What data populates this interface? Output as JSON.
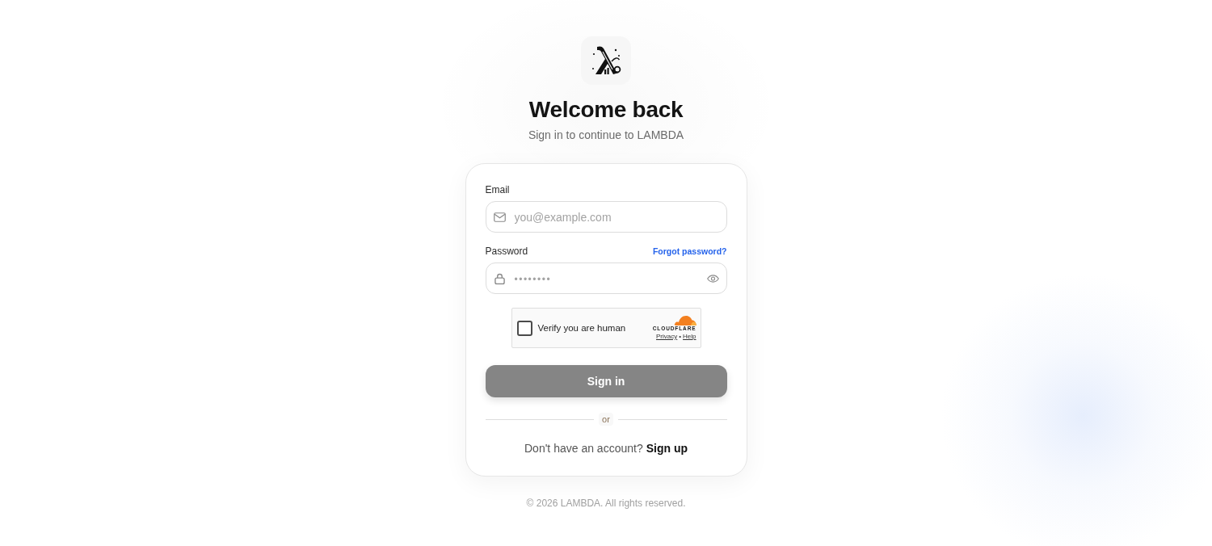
{
  "header": {
    "title": "Welcome back",
    "subtitle": "Sign in to continue to LAMBDA"
  },
  "form": {
    "fields": [
      {
        "kind": "email",
        "label": "Email",
        "placeholder": "you@example.com"
      },
      {
        "kind": "password",
        "label": "Password",
        "link": "Forgot password?",
        "placeholder": "••••••••"
      }
    ],
    "captcha": {
      "label": "Verify you are human",
      "checked": false,
      "brand": "CLOUDFLARE",
      "privacy_link": "Privacy",
      "separator": "•",
      "help_link": "Help"
    },
    "submit": {
      "label": "Sign in",
      "disabled": true
    },
    "divider": "or",
    "signup": {
      "prompt": "Don't have an account?",
      "link": "Sign up"
    }
  },
  "footer": {
    "text": "© 2026 LAMBDA. All rights reserved."
  }
}
